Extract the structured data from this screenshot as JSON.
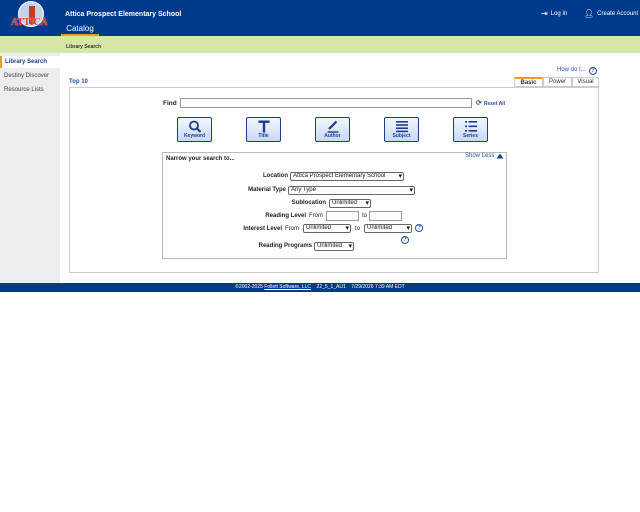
{
  "header": {
    "logo_text": "ATTICA",
    "school_name": "Attica Prospect Elementary School",
    "catalog_tab": "Catalog",
    "login_label": "Log In",
    "create_account_label": "Create Account"
  },
  "subbar": {
    "breadcrumb": "Library Search"
  },
  "sidebar": {
    "items": [
      {
        "label": "Library Search"
      },
      {
        "label": "Destiny Discover"
      },
      {
        "label": "Resource Lists"
      }
    ]
  },
  "main": {
    "how_do_i": "How do I...",
    "top10": "Top 10",
    "modes": {
      "basic": "Basic",
      "power": "Power",
      "visual": "Visual"
    },
    "find_label": "Find",
    "find_value": "",
    "reset_all": "Reset All",
    "search_buttons": {
      "keyword": "Keyword",
      "title": "Title",
      "author": "Author",
      "subject": "Subject",
      "series": "Series"
    }
  },
  "narrow": {
    "title": "Narrow your search to...",
    "show_less": "Show Less",
    "location_label": "Location",
    "location_value": "Attica Prospect Elementary School",
    "material_label": "Material Type",
    "material_value": "Any Type",
    "sublocation_label": "Sublocation",
    "sublocation_value": "Unlimited",
    "reading_level_label": "Reading Level",
    "interest_level_label": "Interest Level",
    "from_label": "From",
    "to_label": "to",
    "interest_from_value": "Unlimited",
    "interest_to_value": "Unlimited",
    "reading_programs_label": "Reading Programs",
    "reading_programs_value": "Unlimited"
  },
  "footer": {
    "copyright": "©2002-2025",
    "company_link": "Follett Software, LLC",
    "version": "22_5_1_AU1",
    "timestamp": "7/29/2026 7:39 AM EDT"
  },
  "colors": {
    "header_blue": "#003a8c",
    "subbar_green": "#d5e8a8",
    "accent_orange": "#f29b1d",
    "link_blue": "#2a4ea0"
  }
}
